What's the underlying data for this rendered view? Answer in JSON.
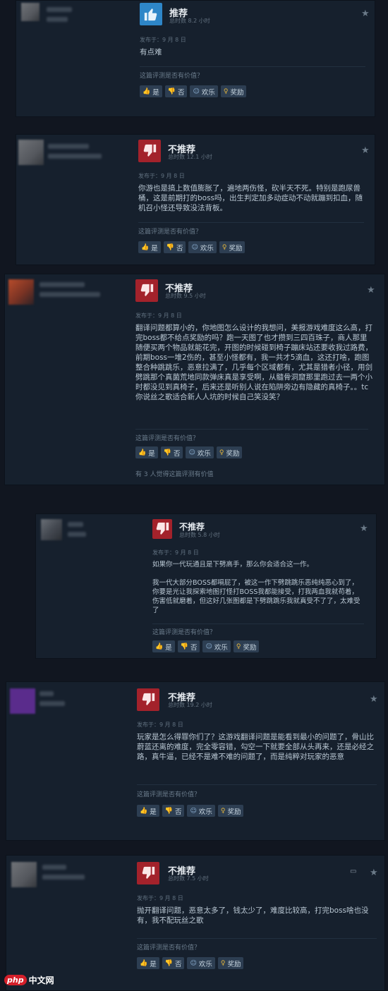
{
  "reviews": [
    {
      "verdict": "推荐",
      "hours": "总时数 8.2 小时",
      "posted": "发布于：9 月 8 日",
      "body": "有点难",
      "helpful_q": "这篇评测是否有价值？",
      "buttons": {
        "yes": "是",
        "no": "否",
        "funny": "欢乐",
        "award": "奖励"
      }
    },
    {
      "verdict": "不推荐",
      "hours": "总时数 12.1 小时",
      "posted": "发布于：9 月 8 日",
      "body": "你游也是搞上数值膨胀了，遍地两伤怪，砍半天不死。特别是跑尿兽桶，这是前期打的boss吗，出生判定加多动症动不动就蹦到扣血，随机召小怪还导致没法背板。",
      "helpful_q": "这篇评测是否有价值？",
      "buttons": {
        "yes": "是",
        "no": "否",
        "funny": "欢乐",
        "award": "奖励"
      }
    },
    {
      "verdict": "不推荐",
      "hours": "总时数 9.5 小时",
      "posted": "发布于：9 月 8 日",
      "body": "翻译问题都算小的，你地图怎么设计的我想问，美报游戏难度这么高，打完boss都不给点奖励的吗？跑一天图了也才攒到三四百珠子，商人那里随便买两个物品就能花完，开图的时候碰到椅子蹦床站还要收我过路费，前期boss一堆2伤的，甚至小怪都有，我一共才5滴血，这还打啥，跑图整合种跳跳乐，恶意拉满了，几乎每个区域都有，尤其是猎者小径，用剑劈跳那个真菌荒地同款弹床真是享受啊，从髓骨洞窟那里跑过去一两个小时都没见到真椅子，后来还是听别人说在陷阱旁边有隐藏的真椅子。。tc你说丝之歌适合新人人坑的时候自己笑没笑？",
      "helpful_q": "这篇评测是否有价值？",
      "buttons": {
        "yes": "是",
        "no": "否",
        "funny": "欢乐",
        "award": "奖励"
      },
      "footer": "有 3 人觉得这篇评测有价值"
    },
    {
      "verdict": "不推荐",
      "hours": "总时数 5.8 小时",
      "posted": "发布于：9 月 8 日",
      "body": "如果你一代玩通且是下劈高手，那么你会适合这一作。",
      "body2": "我一代大部分BOSS都嗝屁了，被这一作下劈跳跳乐恶纯纯恶心到了，你要是光让我探索地图打怪打BOSS我都能接受，打我两血我就苟着，伤害低就磨着，但这好几张图都是下劈跳跳乐我就真受不了了，太难受了",
      "helpful_q": "这篇评测是否有价值？",
      "buttons": {
        "yes": "是",
        "no": "否",
        "funny": "欢乐",
        "award": "奖励"
      }
    },
    {
      "verdict": "不推荐",
      "hours": "总时数 19.2 小时",
      "posted": "发布于：9 月 8 日",
      "body": "玩家是怎么得罪你们了？这游戏翻译问题是能看到最小的问题了，骨山比蔚蓝还离的难度，完全零容错，勾空一下就要全部从头再来，还是必经之路，真牛逼，已经不是难不难的问题了，而是纯粹对玩家的恶意",
      "helpful_q": "这篇评测是否有价值？",
      "buttons": {
        "yes": "是",
        "no": "否",
        "funny": "欢乐",
        "award": "奖励"
      }
    },
    {
      "verdict": "不推荐",
      "hours": "总时数 7.5 小时",
      "posted": "发布于：9 月 8 日",
      "body": "抛开翻译问题，恶意太多了，钱太少了，难度比较高，打完boss啥也没有，我不配玩丝之歌",
      "helpful_q": "这篇评测是否有价值？",
      "buttons": {
        "yes": "是",
        "no": "否",
        "funny": "欢乐",
        "award": "奖励"
      }
    }
  ],
  "watermark": {
    "badge": "php",
    "text": "中文网"
  },
  "colors": {
    "recommend": "#2e86c8",
    "not_recommend": "#a3222b",
    "panel": "#16202d",
    "button": "#2d3e52"
  }
}
